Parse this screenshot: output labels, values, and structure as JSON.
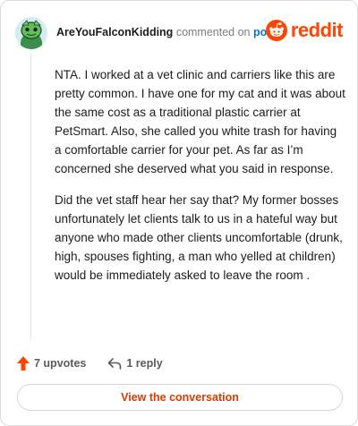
{
  "comment": {
    "author": "AreYouFalconKidding",
    "action": "commented on",
    "target": "post",
    "paragraphs": [
      "NTA. I worked at a vet clinic and carriers like this are pretty common. I have one for my cat and it was about the same cost as a traditional plastic carrier at PetSmart. Also, she called you white trash for having a comfortable carrier for your pet. As far as I’m concerned she deserved what you said in response.",
      "Did the vet staff hear her say that? My former bosses unfortunately let clients talk to us in a hateful way but anyone who made other clients uncomfortable (drunk, high, spouses fighting, a man who yelled at children) would be immediately asked to leave the room ."
    ]
  },
  "brand": {
    "wordmark": "reddit",
    "icon": "reddit-snoo-icon",
    "color": "#ff4500"
  },
  "footer": {
    "upvotes": "7 upvotes",
    "replies": "1 reply",
    "upvote_icon": "upvote-arrow-icon",
    "reply_icon": "reply-arrow-icon",
    "upvote_color": "#ff4500"
  },
  "cta": {
    "label": "View the conversation",
    "color": "#d93900"
  }
}
